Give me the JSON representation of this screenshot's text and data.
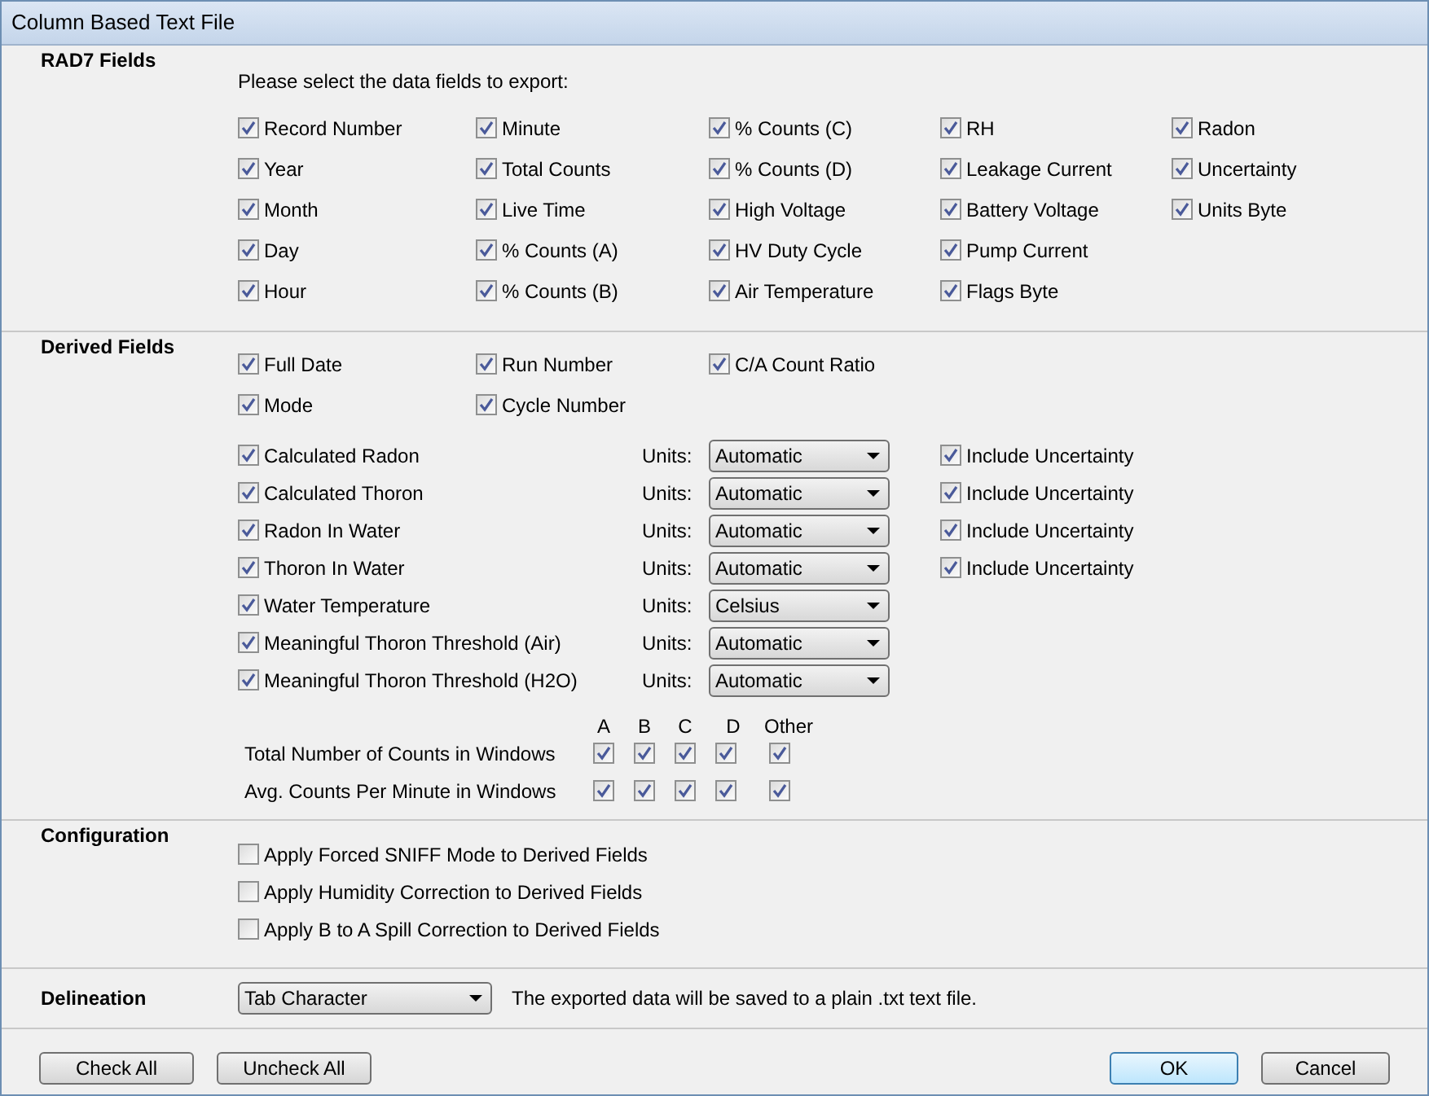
{
  "window": {
    "title": "Column Based Text File"
  },
  "rad7_fields": {
    "title": "RAD7 Fields",
    "prompt": "Please select the data fields to export:",
    "columns": [
      [
        {
          "label": "Record Number",
          "checked": true
        },
        {
          "label": "Year",
          "checked": true
        },
        {
          "label": "Month",
          "checked": true
        },
        {
          "label": "Day",
          "checked": true
        },
        {
          "label": "Hour",
          "checked": true
        }
      ],
      [
        {
          "label": "Minute",
          "checked": true
        },
        {
          "label": "Total Counts",
          "checked": true
        },
        {
          "label": "Live Time",
          "checked": true
        },
        {
          "label": "% Counts (A)",
          "checked": true
        },
        {
          "label": "% Counts (B)",
          "checked": true
        }
      ],
      [
        {
          "label": "% Counts (C)",
          "checked": true
        },
        {
          "label": "% Counts (D)",
          "checked": true
        },
        {
          "label": "High Voltage",
          "checked": true
        },
        {
          "label": "HV Duty Cycle",
          "checked": true
        },
        {
          "label": "Air Temperature",
          "checked": true
        }
      ],
      [
        {
          "label": "RH",
          "checked": true
        },
        {
          "label": "Leakage Current",
          "checked": true
        },
        {
          "label": "Battery Voltage",
          "checked": true
        },
        {
          "label": "Pump Current",
          "checked": true
        },
        {
          "label": "Flags Byte",
          "checked": true
        }
      ],
      [
        {
          "label": "Radon",
          "checked": true
        },
        {
          "label": "Uncertainty",
          "checked": true
        },
        {
          "label": "Units Byte",
          "checked": true
        }
      ]
    ]
  },
  "derived_fields": {
    "title": "Derived Fields",
    "fields": [
      {
        "label": "Full Date",
        "checked": true
      },
      {
        "label": "Run Number",
        "checked": true
      },
      {
        "label": "C/A Count Ratio",
        "checked": true
      },
      {
        "label": "Mode",
        "checked": true
      },
      {
        "label": "Cycle Number",
        "checked": true
      }
    ],
    "unit_fields": [
      {
        "label": "Calculated Radon",
        "checked": true,
        "units_label": "Units:",
        "units": "Automatic",
        "uncertainty": {
          "label": "Include Uncertainty",
          "checked": true
        }
      },
      {
        "label": "Calculated Thoron",
        "checked": true,
        "units_label": "Units:",
        "units": "Automatic",
        "uncertainty": {
          "label": "Include Uncertainty",
          "checked": true
        }
      },
      {
        "label": "Radon In Water",
        "checked": true,
        "units_label": "Units:",
        "units": "Automatic",
        "uncertainty": {
          "label": "Include Uncertainty",
          "checked": true
        }
      },
      {
        "label": "Thoron In Water",
        "checked": true,
        "units_label": "Units:",
        "units": "Automatic",
        "uncertainty": {
          "label": "Include Uncertainty",
          "checked": true
        }
      },
      {
        "label": "Water Temperature",
        "checked": true,
        "units_label": "Units:",
        "units": "Celsius"
      },
      {
        "label": "Meaningful Thoron Threshold (Air)",
        "checked": true,
        "units_label": "Units:",
        "units": "Automatic"
      },
      {
        "label": "Meaningful Thoron Threshold (H2O)",
        "checked": true,
        "units_label": "Units:",
        "units": "Automatic"
      }
    ],
    "window_counts": {
      "headers": [
        "A",
        "B",
        "C",
        "D",
        "Other"
      ],
      "rows": [
        {
          "label": "Total Number of Counts in Windows",
          "checks": [
            {
              "checked": true
            },
            {
              "checked": true
            },
            {
              "checked": true
            },
            {
              "checked": true
            },
            {
              "checked": true
            }
          ]
        },
        {
          "label": "Avg. Counts Per Minute in Windows",
          "checks": [
            {
              "checked": true
            },
            {
              "checked": true
            },
            {
              "checked": true
            },
            {
              "checked": true
            },
            {
              "checked": true
            }
          ]
        }
      ]
    }
  },
  "configuration": {
    "title": "Configuration",
    "options": [
      {
        "label": "Apply Forced SNIFF Mode to Derived Fields",
        "checked": false
      },
      {
        "label": "Apply Humidity Correction to Derived Fields",
        "checked": false
      },
      {
        "label": "Apply B to A Spill Correction to Derived Fields",
        "checked": false
      }
    ]
  },
  "delineation": {
    "title": "Delineation",
    "value": "Tab Character",
    "note": "The exported data will be saved to a plain .txt text file."
  },
  "buttons": {
    "left": [
      "Check All",
      "Uncheck All"
    ],
    "right": [
      {
        "label": "OK",
        "default": true
      },
      {
        "label": "Cancel",
        "default": false
      }
    ]
  }
}
